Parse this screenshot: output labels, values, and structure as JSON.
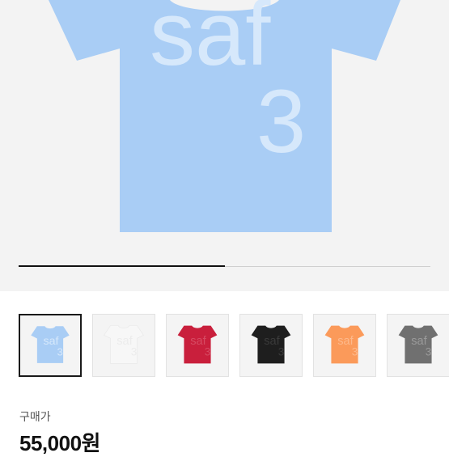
{
  "product": {
    "image_text_line1": "saf",
    "image_text_line2": "3",
    "shirt_color": "#a9cdf5",
    "shirt_text_color": "#d6e8fb",
    "gallery_progress": 0.5
  },
  "thumbnails": [
    {
      "color": "#a9cdf5",
      "text_color": "#d6e8fb",
      "text1": "saf",
      "text2": "3",
      "selected": true
    },
    {
      "color": "#f7f7f7",
      "text_color": "#ececec",
      "text1": "saf",
      "text2": "3",
      "selected": false
    },
    {
      "color": "#c91f3c",
      "text_color": "#d64a62",
      "text1": "saf",
      "text2": "3",
      "selected": false
    },
    {
      "color": "#1e1e1e",
      "text_color": "#3a3a3a",
      "text1": "saf",
      "text2": "3",
      "selected": false
    },
    {
      "color": "#fb9a5a",
      "text_color": "#fdb98b",
      "text1": "saf",
      "text2": "3",
      "selected": false
    },
    {
      "color": "#707070",
      "text_color": "#9a9a9a",
      "text1": "saf",
      "text2": "3",
      "selected": false
    }
  ],
  "pricing": {
    "label": "구매가",
    "value": "55,000원"
  }
}
